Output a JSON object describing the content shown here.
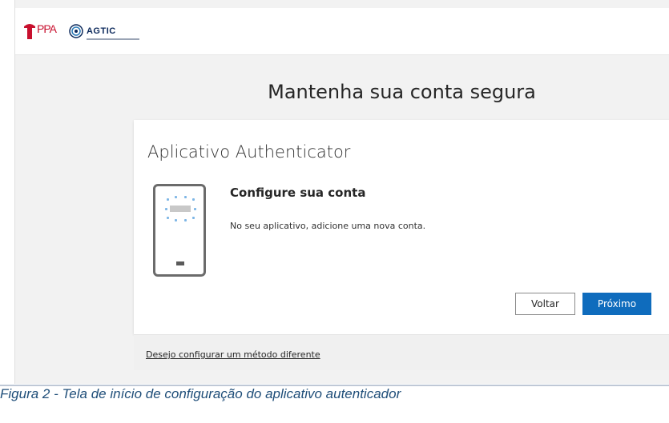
{
  "header": {
    "logo_ppa_text": "PPA",
    "logo_agtic_text": "AGTIC",
    "logo_ppa_icon": "ppa-logo-icon",
    "logo_agtic_icon": "agtic-logo-icon"
  },
  "page": {
    "title": "Mantenha sua conta segura"
  },
  "card": {
    "title": "Aplicativo Authenticator",
    "illustration_icon": "phone-icon",
    "heading": "Configure sua conta",
    "instruction": "No seu aplicativo, adicione uma nova conta.",
    "back_label": "Voltar",
    "next_label": "Próximo",
    "alt_method_link": "Desejo configurar um método diferente"
  },
  "caption": "Figura 2 - Tela de início de configuração do aplicativo autenticador",
  "colors": {
    "primary_button": "#0f6cbd",
    "caption_text": "#1f4e79",
    "ppa_red": "#c8102e",
    "agtic_navy": "#0d2a5c"
  }
}
